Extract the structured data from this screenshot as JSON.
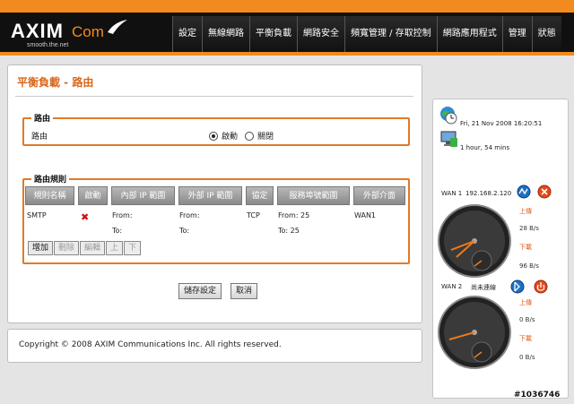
{
  "header": {
    "brand": "AXIM",
    "brand_suffix": "Com",
    "tagline": "smooth.the.net",
    "nav": [
      "設定",
      "無線網路",
      "平衡負載",
      "網路安全",
      "頻寬管理 / 存取控制",
      "網路應用程式",
      "管理",
      "狀態"
    ]
  },
  "main": {
    "title": "平衡負載 - 路由",
    "routing": {
      "legend": "路由",
      "label": "路由",
      "enable_label": "啟動",
      "disable_label": "關閉",
      "selected": "啟動"
    },
    "rules": {
      "legend": "路由規則",
      "columns": [
        "規則名稱",
        "啟動",
        "內部 IP 範圍",
        "外部 IP 範圍",
        "協定",
        "服務埠號範圍",
        "外部介面"
      ],
      "rows": [
        {
          "name": "SMTP",
          "enabled": false,
          "internal_from": "From:",
          "internal_to": "To:",
          "external_from": "From:",
          "external_to": "To:",
          "protocol": "TCP",
          "port_from": "From: 25",
          "port_to": "To: 25",
          "interface": "WAN1"
        }
      ],
      "buttons": {
        "add": "增加",
        "delete": "刪除",
        "edit": "編輯",
        "up": "上",
        "down": "下"
      }
    },
    "save_label": "儲存設定",
    "cancel_label": "取消"
  },
  "footer": {
    "copyright": "Copyright © 2008 AXIM Communications Inc. All rights reserved."
  },
  "status": {
    "datetime": "Fri, 21 Nov 2008 16:20:51",
    "uptime": "1 hour, 54 mins",
    "wan1": {
      "label": "WAN 1",
      "ip": "192.168.2.120",
      "upload_label": "上傳",
      "upload_value": "28 B/s",
      "download_label": "下載",
      "download_value": "96 B/s"
    },
    "wan2": {
      "label": "WAN 2",
      "state": "尚未連線",
      "upload_label": "上傳",
      "upload_value": "0 B/s",
      "download_label": "下載",
      "download_value": "0 B/s"
    }
  },
  "watermark": "#1036746",
  "colors": {
    "accent": "#f28a1e",
    "title": "#d9661a",
    "fieldset_border": "#e07a2a",
    "header_bg": "#101010"
  }
}
